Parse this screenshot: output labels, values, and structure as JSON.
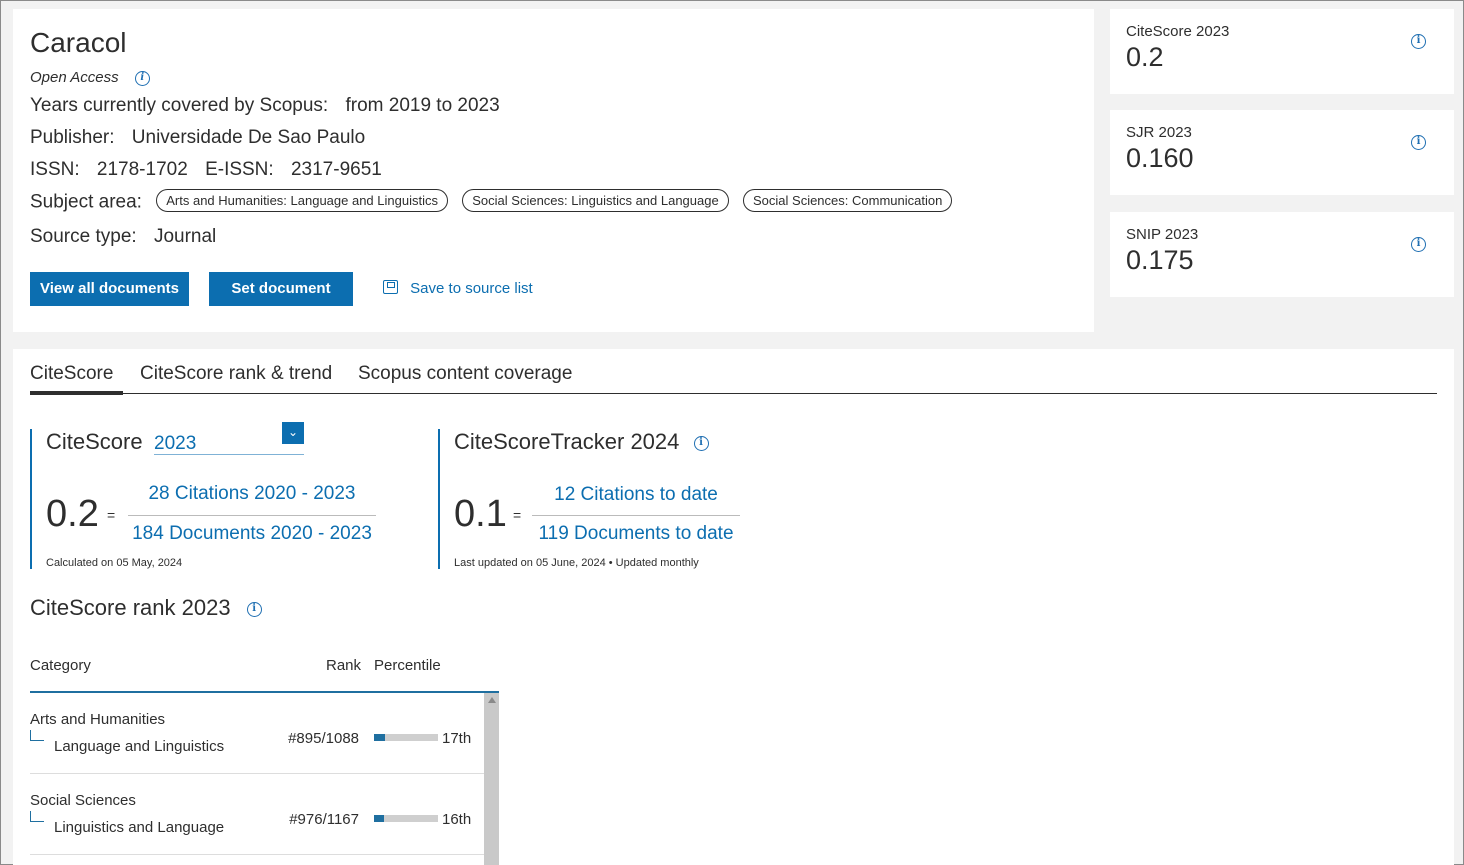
{
  "source": {
    "title": "Caracol",
    "access": "Open Access",
    "years_label": "Years currently covered by Scopus:",
    "years_value": "from 2019 to 2023",
    "publisher_label": "Publisher:",
    "publisher_value": "Universidade De Sao Paulo",
    "issn_label": "ISSN:",
    "issn_value": "2178-1702",
    "eissn_label": "E-ISSN:",
    "eissn_value": "2317-9651",
    "subject_label": "Subject area:",
    "subjects": [
      "Arts and Humanities: Language and Linguistics",
      "Social Sciences: Linguistics and Language",
      "Social Sciences: Communication"
    ],
    "source_type_label": "Source type:",
    "source_type_value": "Journal"
  },
  "actions": {
    "view_all": "View all documents",
    "set_alert": "Set document alert",
    "save_list": "Save to source list"
  },
  "metrics": [
    {
      "label": "CiteScore 2023",
      "value": "0.2"
    },
    {
      "label": "SJR 2023",
      "value": "0.160"
    },
    {
      "label": "SNIP 2023",
      "value": "0.175"
    }
  ],
  "tabs": [
    "CiteScore",
    "CiteScore rank & trend",
    "Scopus content coverage"
  ],
  "citescore": {
    "title": "CiteScore",
    "year": "2023",
    "value": "0.2",
    "equals": "=",
    "numerator": "28 Citations 2020 - 2023",
    "denominator": "184 Documents 2020 - 2023",
    "note": "Calculated on 05 May, 2024"
  },
  "tracker": {
    "title": "CiteScoreTracker 2024",
    "value": "0.1",
    "equals": "=",
    "numerator": "12 Citations to date",
    "denominator": "119 Documents to date",
    "note": "Last updated on 05 June, 2024 • Updated monthly"
  },
  "rank": {
    "title": "CiteScore rank 2023",
    "headers": {
      "category": "Category",
      "rank": "Rank",
      "percentile": "Percentile"
    },
    "rows": [
      {
        "parent": "Arts and Humanities",
        "child": "Language and Linguistics",
        "rank": "#895/1088",
        "percentile": "17th",
        "percentile_value": 17
      },
      {
        "parent": "Social Sciences",
        "child": "Linguistics and Language",
        "rank": "#976/1167",
        "percentile": "16th",
        "percentile_value": 16
      }
    ]
  },
  "icons": {
    "info": "info-icon",
    "save": "save-icon",
    "chevron": "chevron-right-icon",
    "dropdown": "chevron-down-icon"
  },
  "colors": {
    "accent": "#0c6eb0"
  }
}
